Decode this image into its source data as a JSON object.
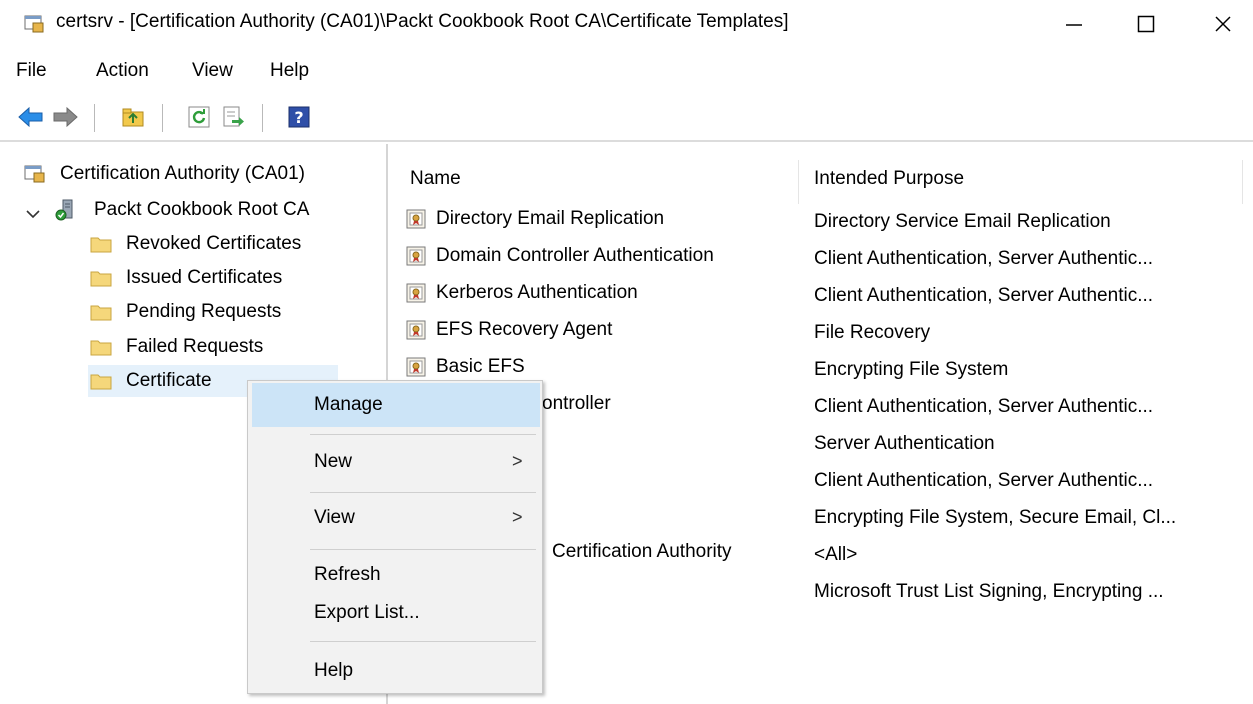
{
  "window": {
    "title": "certsrv - [Certification Authority (CA01)\\Packt Cookbook Root CA\\Certificate Templates]",
    "icon": "certsrv-app-icon"
  },
  "menu": {
    "items": [
      "File",
      "Action",
      "View",
      "Help"
    ]
  },
  "toolbar": {
    "buttons": [
      "back-arrow-icon",
      "forward-arrow-icon",
      "up-folder-icon",
      "refresh-icon",
      "export-list-icon",
      "help-icon"
    ]
  },
  "tree": {
    "root": "Certification Authority (CA01)",
    "ca": "Packt Cookbook Root CA",
    "children": [
      "Revoked Certificates",
      "Issued Certificates",
      "Pending Requests",
      "Failed Requests",
      "Certificate"
    ]
  },
  "list": {
    "columns": [
      "Name",
      "Intended Purpose"
    ],
    "rows": [
      {
        "name": "Directory Email Replication",
        "purpose": "Directory Service Email Replication"
      },
      {
        "name": "Domain Controller Authentication",
        "purpose": "Client Authentication, Server Authentic..."
      },
      {
        "name": "Kerberos Authentication",
        "purpose": "Client Authentication, Server Authentic..."
      },
      {
        "name": "EFS Recovery Agent",
        "purpose": "File Recovery"
      },
      {
        "name": "Basic EFS",
        "purpose": "Encrypting File System"
      },
      {
        "name": "ontroller",
        "purpose": "Client Authentication, Server Authentic..."
      },
      {
        "name": "",
        "purpose": "Server Authentication"
      },
      {
        "name": "",
        "purpose": "Client Authentication, Server Authentic..."
      },
      {
        "name": "",
        "purpose": "Encrypting File System, Secure Email, Cl..."
      },
      {
        "name": "Certification Authority",
        "purpose": "<All>"
      },
      {
        "name": "",
        "purpose": "Microsoft Trust List Signing, Encrypting ..."
      }
    ]
  },
  "context_menu": {
    "items": [
      "Manage",
      "New",
      "View",
      "Refresh",
      "Export List...",
      "Help"
    ],
    "submenu_arrow": ">"
  },
  "colors": {
    "selection": "#e5f1fb",
    "menu_hover": "#cce4f7",
    "menu_background": "#f2f2f2"
  }
}
